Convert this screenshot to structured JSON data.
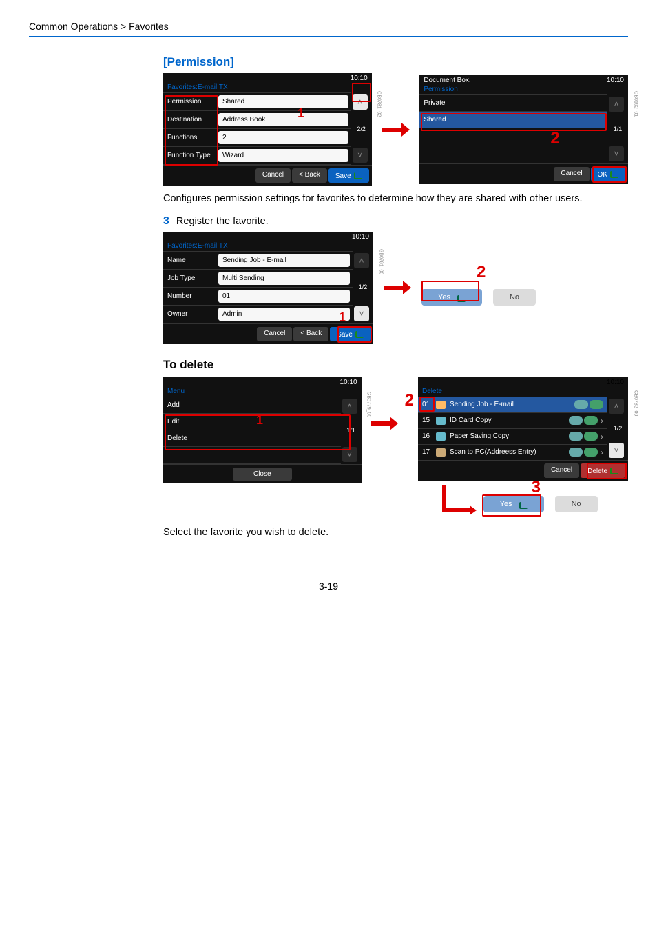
{
  "breadcrumb": "Common Operations > Favorites",
  "permission_heading": "[Permission]",
  "body_text_1": "Configures permission settings for favorites to determine how they are shared with other users.",
  "step3": {
    "num": "3",
    "text": "Register the favorite."
  },
  "to_delete_heading": "To delete",
  "body_text_2": "Select the favorite you wish to delete.",
  "page_number": "3-19",
  "panelA": {
    "time": "10:10",
    "title": "Favorites:E-mail TX",
    "rows": {
      "permission_label": "Permission",
      "permission_value": "Shared",
      "destination_label": "Destination",
      "destination_value": "Address Book",
      "functions_label": "Functions",
      "functions_value": "2",
      "ftype_label": "Function Type",
      "ftype_value": "Wizard"
    },
    "pager": "2/2",
    "btn_cancel": "Cancel",
    "btn_back": "< Back",
    "btn_save": "Save",
    "side": "GB0781_02",
    "red_num": "1"
  },
  "panelB": {
    "title": "Document Box.",
    "subtitle": "Permission",
    "time": "10:10",
    "rows": {
      "private": "Private",
      "shared": "Shared"
    },
    "pager": "1/1",
    "btn_cancel": "Cancel",
    "btn_ok": "OK",
    "side": "GB0192_01",
    "red_num": "2"
  },
  "panelC": {
    "time": "10:10",
    "title": "Favorites:E-mail TX",
    "rows": {
      "name_label": "Name",
      "name_value": "Sending Job - E-mail",
      "jobtype_label": "Job Type",
      "jobtype_value": "Multi Sending",
      "number_label": "Number",
      "number_value": "01",
      "owner_label": "Owner",
      "owner_value": "Admin"
    },
    "pager": "1/2",
    "btn_cancel": "Cancel",
    "btn_back": "< Back",
    "btn_save": "Save",
    "side": "GB0781_00",
    "red_num": "1"
  },
  "confirm": {
    "yes": "Yes",
    "no": "No",
    "red_num": "2",
    "red_num3": "3"
  },
  "panelD": {
    "time": "10:10",
    "title": "Menu",
    "rows": {
      "add": "Add",
      "edit": "Edit",
      "delete": "Delete"
    },
    "pager": "1/1",
    "btn_close": "Close",
    "side": "GB0779_00",
    "red_num": "1"
  },
  "panelE": {
    "time": "10:10",
    "title": "Delete",
    "rows": [
      {
        "num": "01",
        "label": "Sending Job - E-mail"
      },
      {
        "num": "15",
        "label": "ID Card Copy"
      },
      {
        "num": "16",
        "label": "Paper Saving Copy"
      },
      {
        "num": "17",
        "label": "Scan to PC(Addreess Entry)"
      }
    ],
    "pager": "1/2",
    "btn_cancel": "Cancel",
    "btn_delete": "Delete",
    "side": "GB0782_00",
    "red_num": "2"
  }
}
